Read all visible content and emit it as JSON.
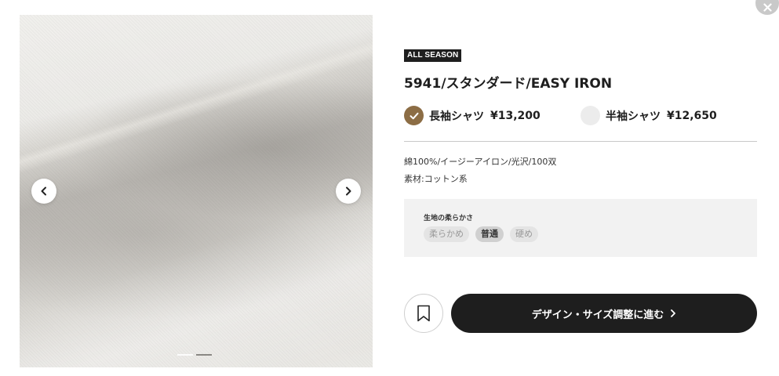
{
  "product": {
    "badge": "ALL SEASON",
    "title": "5941/スタンダード/EASY IRON",
    "options": [
      {
        "label": "長袖シャツ",
        "price": "¥13,200",
        "selected": true
      },
      {
        "label": "半袖シャツ",
        "price": "¥12,650",
        "selected": false
      }
    ],
    "specs": [
      "綿100%/イージーアイロン/光沢/100双",
      "素材:コットン系"
    ]
  },
  "softness": {
    "label": "生地の柔らかさ",
    "levels": [
      "柔らかめ",
      "普通",
      "硬め"
    ],
    "selected": "普通"
  },
  "gallery": {
    "slide_count": 2,
    "active_slide": 2
  },
  "actions": {
    "cta_label": "デザイン・サイズ調整に進む"
  },
  "colors": {
    "accent": "#8c6d45",
    "dark": "#1e1e1e",
    "panel": "#f2f2f2"
  }
}
